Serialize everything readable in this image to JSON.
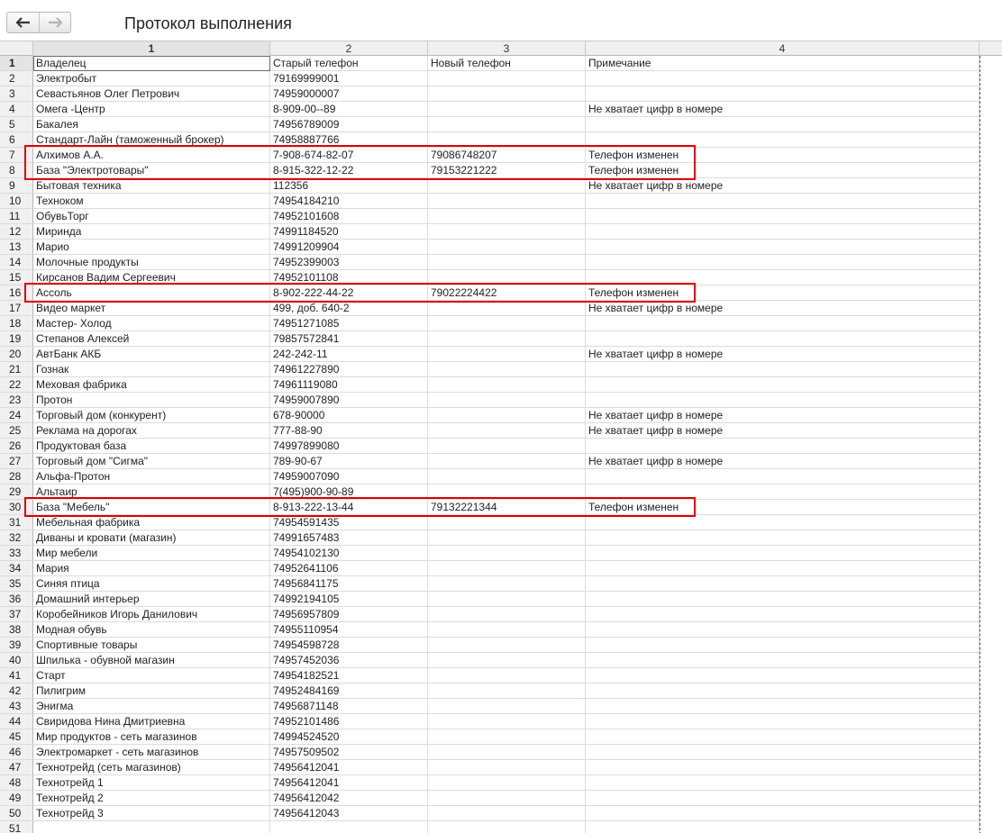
{
  "nav": {
    "back_icon": "arrow-left-icon",
    "forward_icon": "arrow-right-icon"
  },
  "title": "Протокол выполнения",
  "columns": [
    "1",
    "2",
    "3",
    "4"
  ],
  "rows": [
    {
      "n": "1",
      "owner": "Владелец",
      "old": "Старый телефон",
      "new": "Новый телефон",
      "note": "Примечание"
    },
    {
      "n": "2",
      "owner": "Электробыт",
      "old": "79169999001",
      "new": "",
      "note": ""
    },
    {
      "n": "3",
      "owner": "Севастьянов Олег Петрович",
      "old": "74959000007",
      "new": "",
      "note": ""
    },
    {
      "n": "4",
      "owner": "Омега -Центр",
      "old": "8-909-00--89",
      "new": "",
      "note": "Не хватает цифр в номере"
    },
    {
      "n": "5",
      "owner": "Бакалея",
      "old": "74956789009",
      "new": "",
      "note": ""
    },
    {
      "n": "6",
      "owner": "Стандарт-Лайн (таможенный брокер)",
      "old": "74958887766",
      "new": "",
      "note": ""
    },
    {
      "n": "7",
      "owner": "Алхимов А.А.",
      "old": "7-908-674-82-07",
      "new": "79086748207",
      "note": "Телефон изменен"
    },
    {
      "n": "8",
      "owner": "База \"Электротовары\"",
      "old": "8-915-322-12-22",
      "new": "79153221222",
      "note": "Телефон изменен"
    },
    {
      "n": "9",
      "owner": "Бытовая техника",
      "old": "112356",
      "new": "",
      "note": "Не хватает цифр в номере"
    },
    {
      "n": "10",
      "owner": "Техноком",
      "old": "74954184210",
      "new": "",
      "note": ""
    },
    {
      "n": "11",
      "owner": "ОбувьТорг",
      "old": "74952101608",
      "new": "",
      "note": ""
    },
    {
      "n": "12",
      "owner": "Миринда",
      "old": "74991184520",
      "new": "",
      "note": ""
    },
    {
      "n": "13",
      "owner": "Марио",
      "old": "74991209904",
      "new": "",
      "note": ""
    },
    {
      "n": "14",
      "owner": "Молочные продукты",
      "old": "74952399003",
      "new": "",
      "note": ""
    },
    {
      "n": "15",
      "owner": "Кирсанов Вадим Сергеевич",
      "old": "74952101108",
      "new": "",
      "note": ""
    },
    {
      "n": "16",
      "owner": "Ассоль",
      "old": "8-902-222-44-22",
      "new": "79022224422",
      "note": "Телефон изменен"
    },
    {
      "n": "17",
      "owner": "Видео маркет",
      "old": "499, доб. 640-2",
      "new": "",
      "note": "Не хватает цифр в номере"
    },
    {
      "n": "18",
      "owner": "Мастер- Холод",
      "old": "74951271085",
      "new": "",
      "note": ""
    },
    {
      "n": "19",
      "owner": "Степанов Алексей",
      "old": "79857572841",
      "new": "",
      "note": ""
    },
    {
      "n": "20",
      "owner": "АвтБанк АКБ",
      "old": "242-242-11",
      "new": "",
      "note": "Не хватает цифр в номере"
    },
    {
      "n": "21",
      "owner": "Гознак",
      "old": "74961227890",
      "new": "",
      "note": ""
    },
    {
      "n": "22",
      "owner": "Меховая фабрика",
      "old": "74961119080",
      "new": "",
      "note": ""
    },
    {
      "n": "23",
      "owner": "Протон",
      "old": "74959007890",
      "new": "",
      "note": ""
    },
    {
      "n": "24",
      "owner": "Торговый дом (конкурент)",
      "old": "678-90000",
      "new": "",
      "note": "Не хватает цифр в номере"
    },
    {
      "n": "25",
      "owner": "Реклама на дорогах",
      "old": "777-88-90",
      "new": "",
      "note": "Не хватает цифр в номере"
    },
    {
      "n": "26",
      "owner": "Продуктовая база",
      "old": "74997899080",
      "new": "",
      "note": ""
    },
    {
      "n": "27",
      "owner": "Торговый дом \"Сигма\"",
      "old": "789-90-67",
      "new": "",
      "note": "Не хватает цифр в номере"
    },
    {
      "n": "28",
      "owner": "Альфа-Протон",
      "old": "74959007090",
      "new": "",
      "note": ""
    },
    {
      "n": "29",
      "owner": "Альтаир",
      "old": "7(495)900-90-89",
      "new": "",
      "note": ""
    },
    {
      "n": "30",
      "owner": "База \"Мебель\"",
      "old": "8-913-222-13-44",
      "new": "79132221344",
      "note": "Телефон изменен"
    },
    {
      "n": "31",
      "owner": "Мебельная фабрика",
      "old": "74954591435",
      "new": "",
      "note": ""
    },
    {
      "n": "32",
      "owner": "Диваны и кровати (магазин)",
      "old": "74991657483",
      "new": "",
      "note": ""
    },
    {
      "n": "33",
      "owner": "Мир мебели",
      "old": "74954102130",
      "new": "",
      "note": ""
    },
    {
      "n": "34",
      "owner": "Мария",
      "old": "74952641106",
      "new": "",
      "note": ""
    },
    {
      "n": "35",
      "owner": "Синяя птица",
      "old": "74956841175",
      "new": "",
      "note": ""
    },
    {
      "n": "36",
      "owner": "Домашний интерьер",
      "old": "74992194105",
      "new": "",
      "note": ""
    },
    {
      "n": "37",
      "owner": "Коробейников Игорь Данилович",
      "old": "74956957809",
      "new": "",
      "note": ""
    },
    {
      "n": "38",
      "owner": "Модная обувь",
      "old": "74955110954",
      "new": "",
      "note": ""
    },
    {
      "n": "39",
      "owner": "Спортивные товары",
      "old": "74954598728",
      "new": "",
      "note": ""
    },
    {
      "n": "40",
      "owner": "Шпилька - обувной магазин",
      "old": "74957452036",
      "new": "",
      "note": ""
    },
    {
      "n": "41",
      "owner": "Старт",
      "old": "74954182521",
      "new": "",
      "note": ""
    },
    {
      "n": "42",
      "owner": "Пилигрим",
      "old": "74952484169",
      "new": "",
      "note": ""
    },
    {
      "n": "43",
      "owner": "Энигма",
      "old": "74956871148",
      "new": "",
      "note": ""
    },
    {
      "n": "44",
      "owner": "Свиридова Нина Дмитриевна",
      "old": "74952101486",
      "new": "",
      "note": ""
    },
    {
      "n": "45",
      "owner": "Мир продуктов - сеть магазинов",
      "old": "74994524520",
      "new": "",
      "note": ""
    },
    {
      "n": "46",
      "owner": "Электромаркет - сеть магазинов",
      "old": "74957509502",
      "new": "",
      "note": ""
    },
    {
      "n": "47",
      "owner": "Технотрейд (сеть магазинов)",
      "old": "74956412041",
      "new": "",
      "note": ""
    },
    {
      "n": "48",
      "owner": "Технотрейд 1",
      "old": "74956412041",
      "new": "",
      "note": ""
    },
    {
      "n": "49",
      "owner": "Технотрейд 2",
      "old": "74956412042",
      "new": "",
      "note": ""
    },
    {
      "n": "50",
      "owner": "Технотрейд 3",
      "old": "74956412043",
      "new": "",
      "note": ""
    },
    {
      "n": "51",
      "owner": "",
      "old": "",
      "new": "",
      "note": ""
    }
  ],
  "highlighted_rows": [
    "7",
    "8",
    "16",
    "30"
  ]
}
